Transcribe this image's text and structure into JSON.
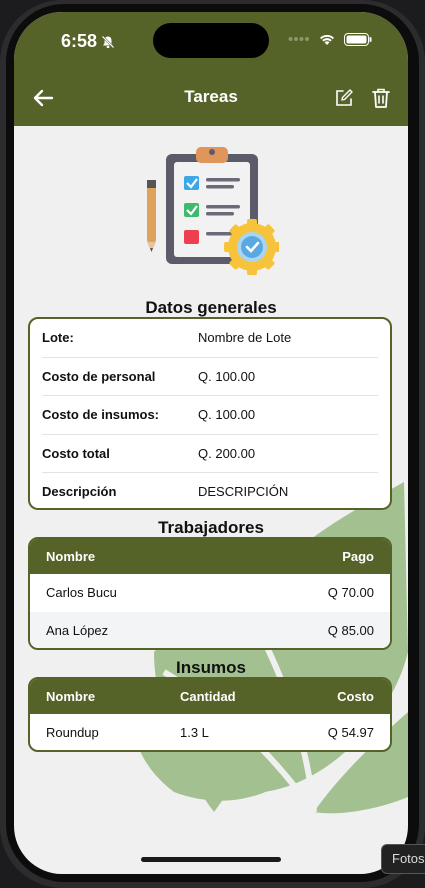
{
  "status_bar": {
    "time": "6:58"
  },
  "header": {
    "title": "Tareas"
  },
  "colors": {
    "primary": "#556228",
    "leaf": "#a3c190"
  },
  "datos_generales": {
    "title": "Datos generales",
    "rows": [
      {
        "label": "Lote:",
        "value": "Nombre de Lote"
      },
      {
        "label": "Costo de personal",
        "value": "Q. 100.00"
      },
      {
        "label": "Costo de insumos:",
        "value": "Q. 100.00"
      },
      {
        "label": "Costo total",
        "value": "Q. 200.00"
      },
      {
        "label": "Descripción",
        "value": "DESCRIPCIÓN"
      }
    ]
  },
  "trabajadores": {
    "title": "Trabajadores",
    "headers": {
      "nombre": "Nombre",
      "pago": "Pago"
    },
    "rows": [
      {
        "nombre": "Carlos Bucu",
        "pago": "Q 70.00"
      },
      {
        "nombre": "Ana López",
        "pago": "Q 85.00"
      }
    ]
  },
  "insumos": {
    "title": "Insumos",
    "headers": {
      "nombre": "Nombre",
      "cantidad": "Cantidad",
      "costo": "Costo"
    },
    "rows": [
      {
        "nombre": "Roundup",
        "cantidad": "1.3 L",
        "costo": "Q 54.97"
      }
    ]
  },
  "tooltip": {
    "text": "Fotos"
  }
}
